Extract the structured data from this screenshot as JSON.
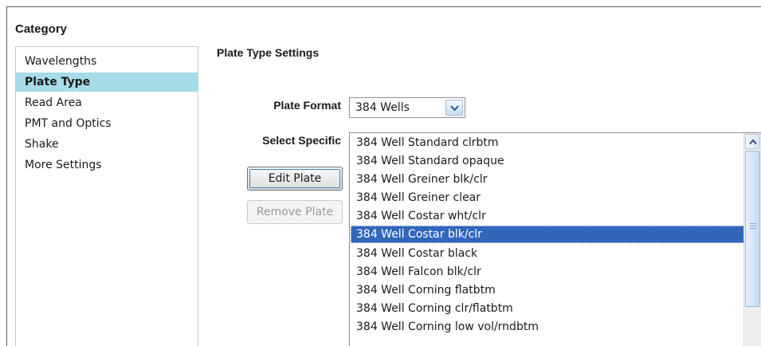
{
  "category": {
    "title": "Category",
    "items": [
      {
        "label": "Wavelengths",
        "selected": false
      },
      {
        "label": "Plate Type",
        "selected": true
      },
      {
        "label": "Read Area",
        "selected": false
      },
      {
        "label": "PMT and Optics",
        "selected": false
      },
      {
        "label": "Shake",
        "selected": false
      },
      {
        "label": "More Settings",
        "selected": false
      }
    ]
  },
  "settings": {
    "title": "Plate Type Settings",
    "plate_format_label": "Plate Format",
    "plate_format_value": "384 Wells",
    "select_specific_label": "Select Specific",
    "edit_plate_label": "Edit Plate",
    "remove_plate_label": "Remove Plate",
    "plates": [
      "384 Well Standard clrbtm",
      "384 Well Standard opaque",
      "384 Well Greiner blk/clr",
      "384 Well Greiner clear",
      "384 Well Costar wht/clr",
      "384 Well Costar blk/clr",
      "384 Well Costar black",
      "384 Well Falcon blk/clr",
      "384 Well Corning flatbtm",
      "384 Well Corning clr/flatbtm",
      "384 Well Corning low vol/rndbtm"
    ],
    "selected_plate": "384 Well Costar blk/clr"
  },
  "colors": {
    "category_selected_bg": "#a6dce8",
    "list_selected_bg": "#3366bb"
  },
  "icons": {
    "dropdown": "chevron-down-icon",
    "scroll_up": "chevron-up-icon"
  }
}
